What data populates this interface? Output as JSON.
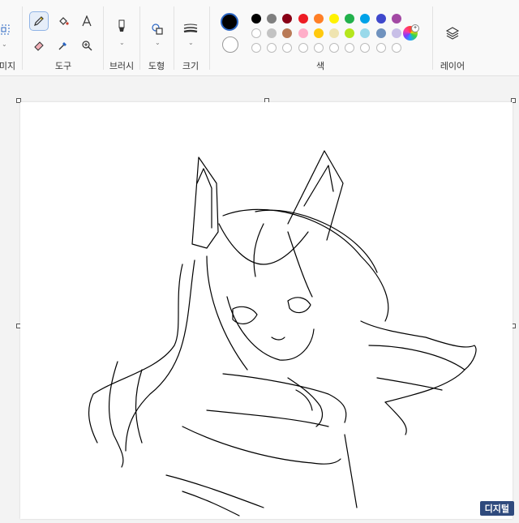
{
  "ribbon": {
    "groups": {
      "image": "미지",
      "tools": "도구",
      "brushes": "브러시",
      "shapes": "도형",
      "size": "크기",
      "colors": "색",
      "layers": "레이어"
    },
    "tools": [
      "pencil-icon",
      "fill-icon",
      "text-icon",
      "eraser-icon",
      "color-picker-icon",
      "magnifier-icon"
    ],
    "active_tool": "pencil",
    "color1": "#000000",
    "color2": "#ffffff",
    "palette_row1": [
      "#000000",
      "#7f7f7f",
      "#880015",
      "#ed1c24",
      "#ff7f27",
      "#fff200",
      "#22b14c",
      "#00a2e8",
      "#3f48cc",
      "#a349a4"
    ],
    "palette_row2": [
      "#ffffff",
      "#c3c3c3",
      "#b97a57",
      "#ffaec9",
      "#ffc90e",
      "#efe4b0",
      "#b5e61d",
      "#99d9ea",
      "#7092be",
      "#c8bfe7"
    ],
    "palette_row3_count": 10
  },
  "watermark": "디지털"
}
